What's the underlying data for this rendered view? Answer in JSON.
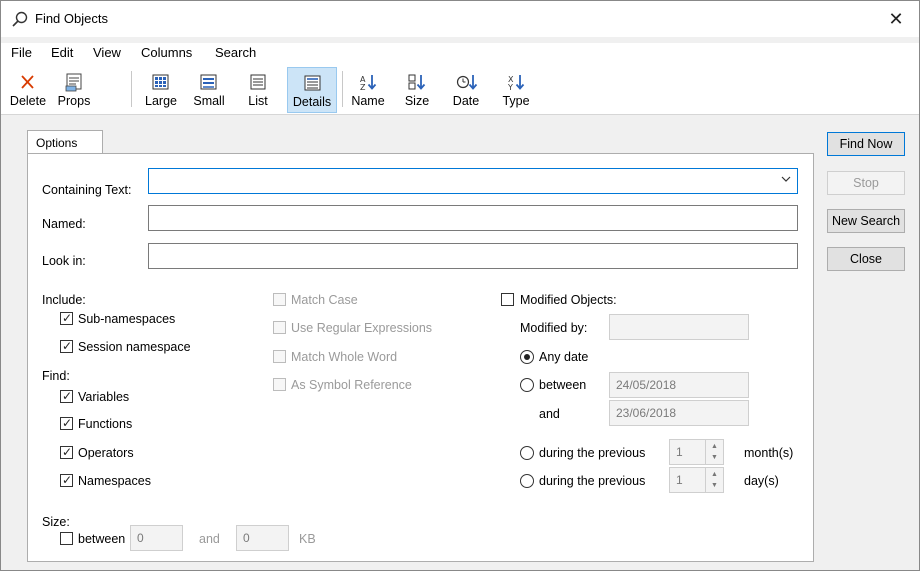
{
  "window": {
    "title": "Find Objects"
  },
  "menu": [
    "File",
    "Edit",
    "View",
    "Columns",
    "Search"
  ],
  "toolbar": {
    "delete": "Delete",
    "props": "Props",
    "large": "Large",
    "small": "Small",
    "list": "List",
    "details": "Details",
    "name": "Name",
    "size": "Size",
    "date": "Date",
    "type": "Type"
  },
  "tab": {
    "label": "Options"
  },
  "form": {
    "containing_text_label": "Containing Text:",
    "containing_text_value": "",
    "named_label": "Named:",
    "named_value": "",
    "look_in_label": "Look in:",
    "look_in_value": "",
    "include_label": "Include:",
    "sub_namespaces": "Sub-namespaces",
    "session_namespace": "Session namespace",
    "find_label": "Find:",
    "variables": "Variables",
    "functions": "Functions",
    "operators": "Operators",
    "namespaces": "Namespaces",
    "match_case": "Match Case",
    "use_regex": "Use Regular Expressions",
    "match_whole_word": "Match Whole Word",
    "as_symbol_reference": "As Symbol Reference",
    "modified_objects": "Modified Objects:",
    "modified_by_label": "Modified by:",
    "modified_by_value": "",
    "any_date": "Any date",
    "between": "between",
    "date_from": "24/05/2018",
    "and_label": "and",
    "date_to": "23/06/2018",
    "during_previous_1": "during the previous",
    "months_value": "1",
    "months_unit": "month(s)",
    "during_previous_2": "during the previous",
    "days_value": "1",
    "days_unit": "day(s)",
    "size_label": "Size:",
    "size_between": "between",
    "size_from": "0",
    "size_and": "and",
    "size_to": "0",
    "size_unit": "KB"
  },
  "buttons": {
    "find_now": "Find Now",
    "stop": "Stop",
    "new_search": "New Search",
    "close": "Close"
  }
}
